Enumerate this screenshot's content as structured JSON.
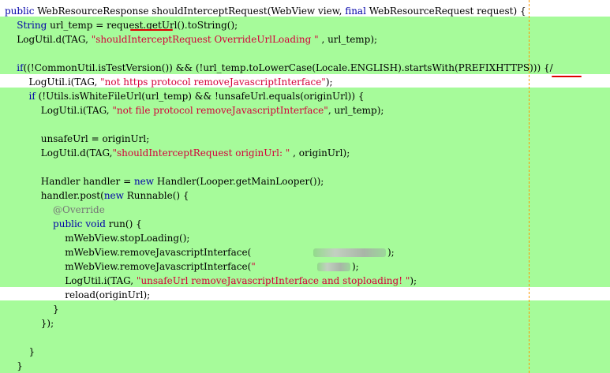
{
  "editor": {
    "lines": [
      "public WebResourceResponse shouldInterceptRequest(WebView view, final WebResourceRequest request) {",
      "    String url_temp = request.getUrl().toString();",
      "    LogUtil.d(TAG, \"shouldInterceptRequest OverrideUrlLoading \" , url_temp);",
      "",
      "    if((!CommonUtil.isTestVersion()) && (!url_temp.toLowerCase(Locale.ENGLISH).startsWith(PREFIXHTTPS))) {/",
      "        LogUtil.i(TAG, \"not https protocol removeJavascriptInterface\");",
      "        if (!Utils.isWhiteFileUrl(url_temp) && !unsafeUrl.equals(originUrl)) {",
      "            LogUtil.i(TAG, \"not file protocol removeJavascriptInterface\", url_temp);",
      "",
      "            unsafeUrl = originUrl;",
      "            LogUtil.d(TAG,\"shouldInterceptRequest originUrl: \" , originUrl);",
      "",
      "            Handler handler = new Handler(Looper.getMainLooper());",
      "            handler.post(new Runnable() {",
      "                @Override",
      "                public void run() {",
      "                    mWebView.stopLoading();",
      "                    mWebView.removeJavascriptInterface(",
      "                    mWebView.removeJavascriptInterface(\"",
      "                    LogUtil.i(TAG, \"unsafeUrl removeJavascriptInterface and stoploading! \");",
      "                    reload(originUrl);",
      "                }",
      "            });",
      "",
      "        }",
      "    }"
    ],
    "line17_tail": ");",
    "line18_tail": ");"
  },
  "colors": {
    "code_background": "#a6fb9a",
    "current_line": "#ffffff",
    "keyword": "#0000a8",
    "string": "#d4003a",
    "annotation": "#767676",
    "margin_guide": "#ff9900",
    "markup_underline": "#e00000"
  }
}
